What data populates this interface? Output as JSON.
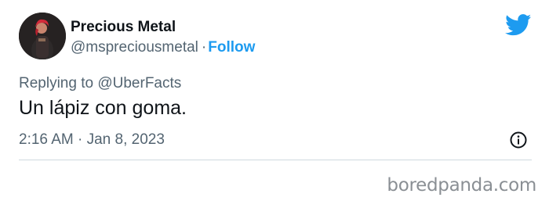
{
  "author": {
    "name": "Precious Metal",
    "handle": "@mspreciousmetal",
    "separator": "·",
    "follow_label": "Follow"
  },
  "reply": {
    "prefix": "Replying to ",
    "to": "@UberFacts"
  },
  "tweet": {
    "text": "Un lápiz con goma.",
    "timestamp": "2:16 AM · Jan 8, 2023"
  },
  "watermark": "boredpanda.com",
  "icons": {
    "brand": "twitter-bird-icon",
    "info": "info-icon"
  },
  "colors": {
    "accent": "#1d9bf0",
    "text": "#0f1419",
    "muted": "#536471",
    "divider": "#cfd9de"
  }
}
